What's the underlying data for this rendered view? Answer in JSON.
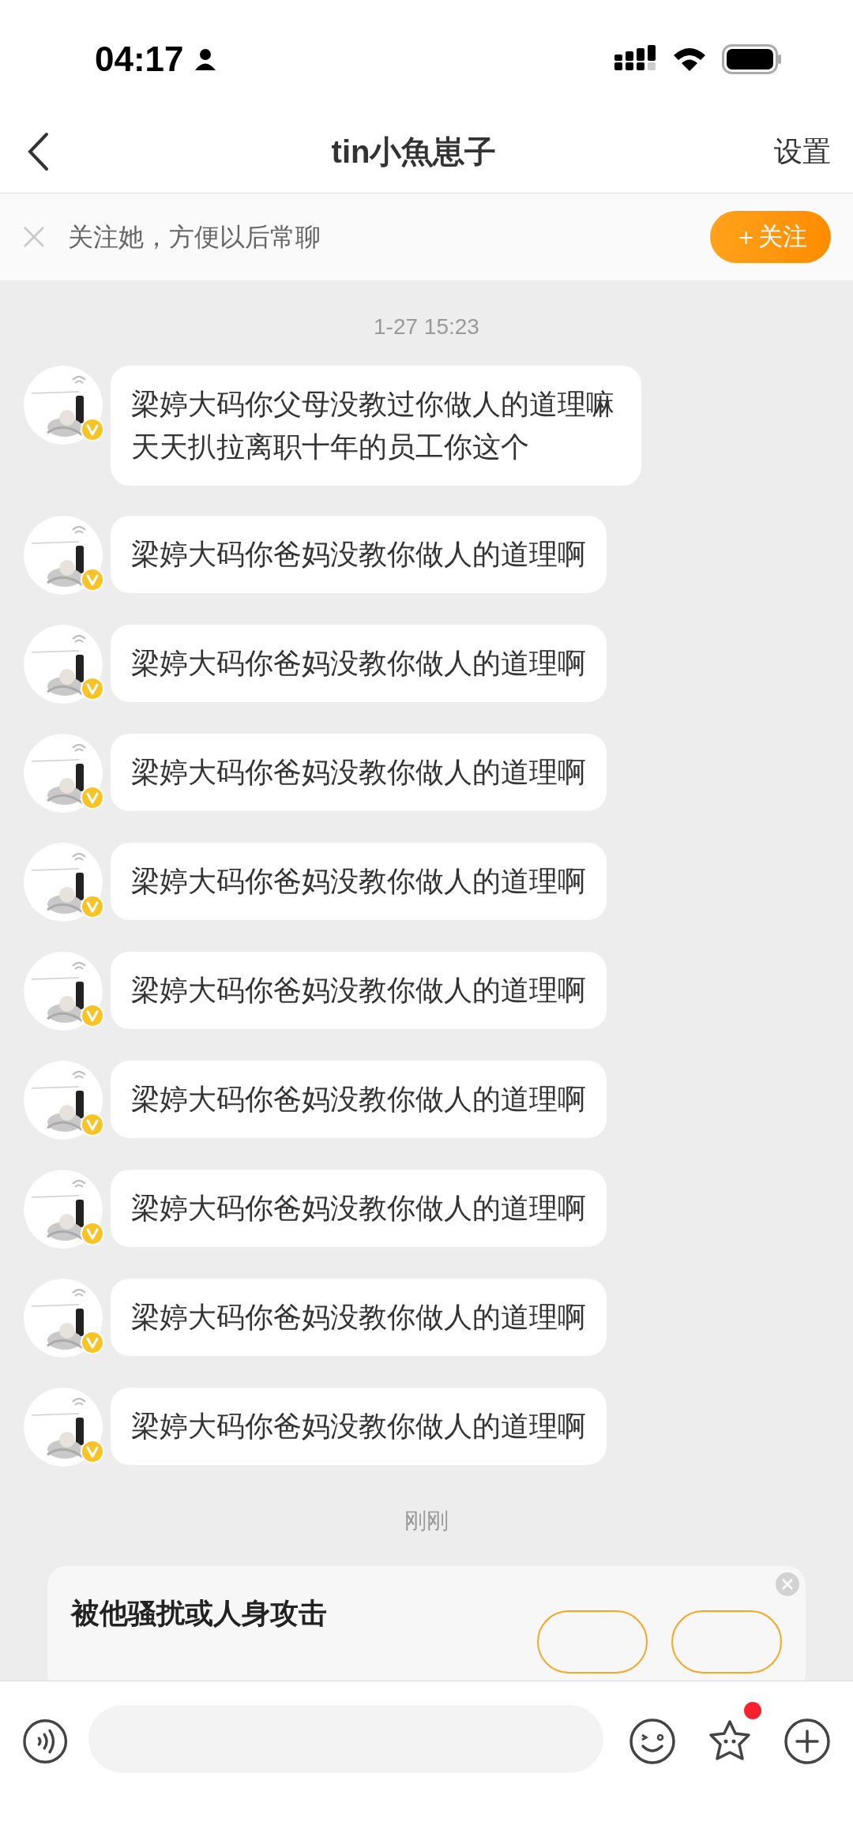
{
  "status_bar": {
    "time": "04:17"
  },
  "header": {
    "title": "tin小魚崽子",
    "settings": "设置"
  },
  "follow_bar": {
    "text": "关注她，方便以后常聊",
    "button": "＋关注"
  },
  "messages": [
    {
      "kind": "time",
      "text": "1-27 15:23"
    },
    {
      "kind": "bubble",
      "text": "梁婷大码你父母没教过你做人的道理嘛天天扒拉离职十年的员工你这个",
      "verified": true
    },
    {
      "kind": "bubble",
      "text": "梁婷大码你爸妈没教你做人的道理啊",
      "verified": true
    },
    {
      "kind": "bubble",
      "text": "梁婷大码你爸妈没教你做人的道理啊",
      "verified": true
    },
    {
      "kind": "bubble",
      "text": "梁婷大码你爸妈没教你做人的道理啊",
      "verified": true
    },
    {
      "kind": "bubble",
      "text": "梁婷大码你爸妈没教你做人的道理啊",
      "verified": true
    },
    {
      "kind": "bubble",
      "text": "梁婷大码你爸妈没教你做人的道理啊",
      "verified": true
    },
    {
      "kind": "bubble",
      "text": "梁婷大码你爸妈没教你做人的道理啊",
      "verified": true
    },
    {
      "kind": "bubble",
      "text": "梁婷大码你爸妈没教你做人的道理啊",
      "verified": true
    },
    {
      "kind": "bubble",
      "text": "梁婷大码你爸妈没教你做人的道理啊",
      "verified": true
    },
    {
      "kind": "bubble",
      "text": "梁婷大码你爸妈没教你做人的道理啊",
      "verified": true
    },
    {
      "kind": "time",
      "text": "刚刚"
    }
  ],
  "safety_card": {
    "title": "被他骚扰或人身攻击"
  },
  "input_bar": {
    "sticker_badge": true
  }
}
